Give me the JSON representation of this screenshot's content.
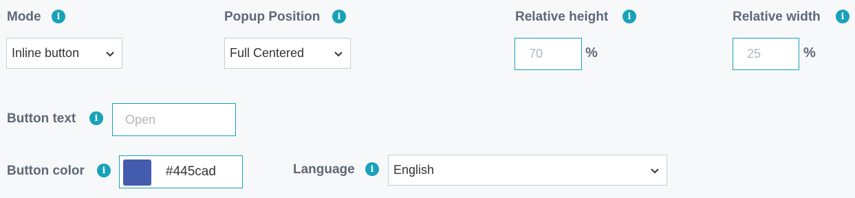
{
  "mode": {
    "label": "Mode",
    "value": "Inline button"
  },
  "popup_position": {
    "label": "Popup Position",
    "value": "Full Centered"
  },
  "relative_height": {
    "label": "Relative height",
    "placeholder": "70",
    "unit": "%"
  },
  "relative_width": {
    "label": "Relative width",
    "placeholder": "25",
    "unit": "%"
  },
  "button_text": {
    "label": "Button text",
    "placeholder": "Open"
  },
  "button_color": {
    "label": "Button color",
    "value": "#445cad",
    "swatch_color": "#445cad"
  },
  "language": {
    "label": "Language",
    "value": "English"
  },
  "colors": {
    "accent": "#17a2b8",
    "label": "#5e6875",
    "background": "#f7f8fa"
  }
}
